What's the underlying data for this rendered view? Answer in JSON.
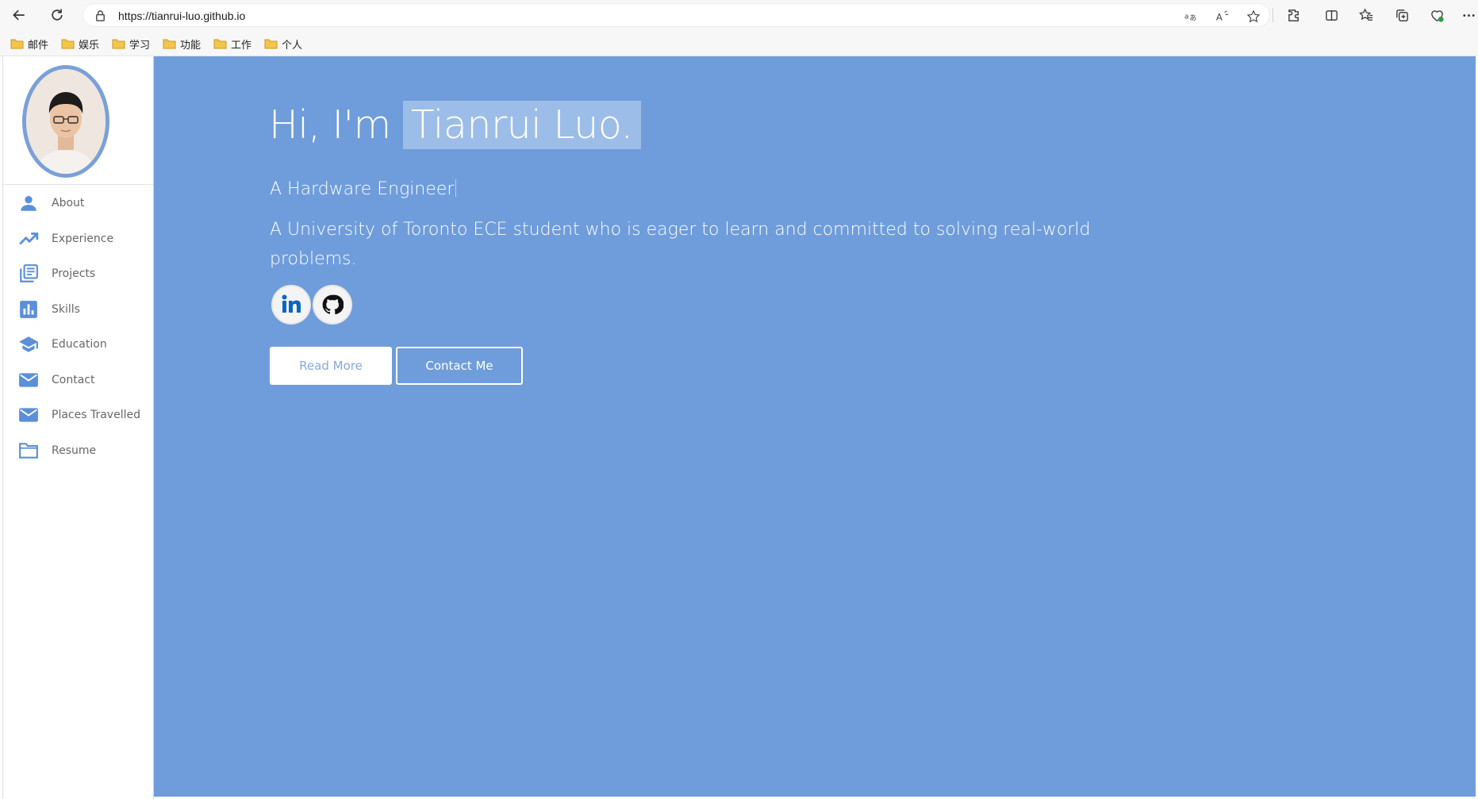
{
  "browser": {
    "url": "https://tianrui-luo.github.io",
    "bookmarks": [
      "邮件",
      "娱乐",
      "学习",
      "功能",
      "工作",
      "个人"
    ],
    "icons": [
      "back-arrow-icon",
      "refresh-icon",
      "lock-icon",
      "translate-icon",
      "read-aloud-icon",
      "favorite-star-icon",
      "extensions-icon",
      "split-screen-icon",
      "favorites-icon",
      "collections-icon",
      "browser-essentials-icon",
      "more-icon"
    ]
  },
  "sidebar": {
    "items": [
      {
        "label": "About",
        "icon": "person-icon"
      },
      {
        "label": "Experience",
        "icon": "trending-up-icon"
      },
      {
        "label": "Projects",
        "icon": "library-books-icon"
      },
      {
        "label": "Skills",
        "icon": "bar-chart-icon"
      },
      {
        "label": "Education",
        "icon": "graduation-cap-icon"
      },
      {
        "label": "Contact",
        "icon": "mail-icon"
      },
      {
        "label": "Places Travelled",
        "icon": "mail-icon"
      },
      {
        "label": "Resume",
        "icon": "folder-icon"
      }
    ]
  },
  "hero": {
    "greeting": "Hi, I'm",
    "name": "Tianrui Luo.",
    "role": "A Hardware Engineer",
    "description": "A University of Toronto ECE student who is eager to learn and committed to solving real-world problems.",
    "read_more": "Read More",
    "contact_me": "Contact Me"
  },
  "colors": {
    "hero_bg": "#6f9ddb",
    "name_highlight": "#9dbde9",
    "sidebar_icon": "#5b8fd9",
    "avatar_border": "#7aa0d8"
  }
}
